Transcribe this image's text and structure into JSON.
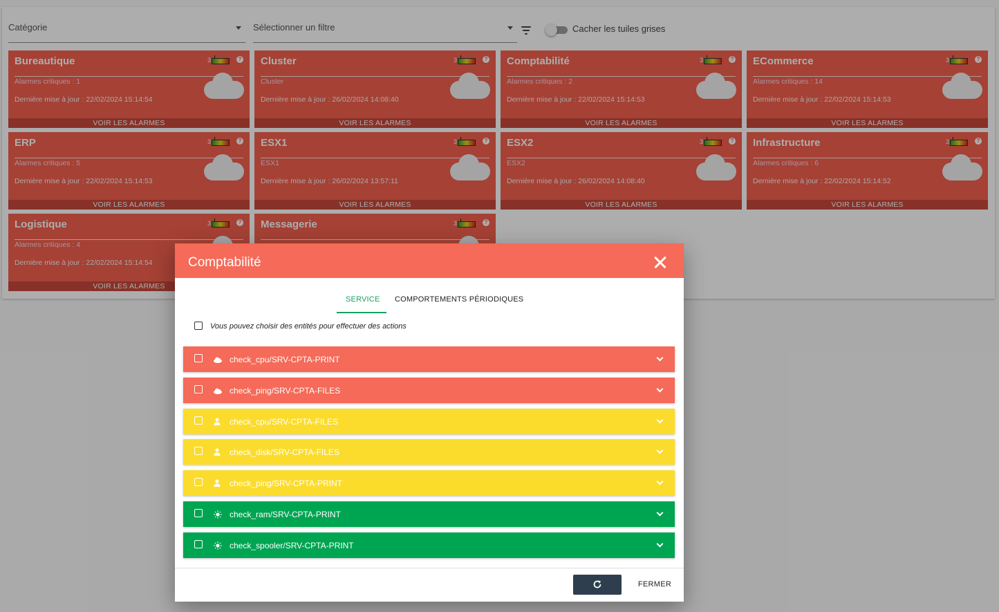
{
  "toolbar": {
    "category_placeholder": "Catégorie",
    "filter_placeholder": "Sélectionner un filtre",
    "hide_grey_label": "Cacher les tuiles grises"
  },
  "tiles": [
    {
      "name": "Bureautique",
      "sub": "Alarmes critiques : 1",
      "date": "Dernière mise à jour : 22/02/2024 15:14:54",
      "count": "3",
      "button": "VOIR LES ALARMES"
    },
    {
      "name": "Cluster",
      "sub": "Cluster",
      "date": "Dernière mise à jour : 26/02/2024 14:08:40",
      "count": "3",
      "button": "VOIR LES ALARMES"
    },
    {
      "name": "Comptabilité",
      "sub": "Alarmes critiques : 2",
      "date": "Dernière mise à jour : 22/02/2024 15:14:53",
      "count": "3",
      "button": "VOIR LES ALARMES"
    },
    {
      "name": "ECommerce",
      "sub": "Alarmes critiques : 14",
      "date": "Dernière mise à jour : 22/02/2024 15:14:53",
      "count": "3",
      "button": "VOIR LES ALARMES"
    },
    {
      "name": "ERP",
      "sub": "Alarmes critiques : 5",
      "date": "Dernière mise à jour : 22/02/2024 15:14:53",
      "count": "3",
      "button": "VOIR LES ALARMES"
    },
    {
      "name": "ESX1",
      "sub": "ESX1",
      "date": "Dernière mise à jour : 26/02/2024 13:57:11",
      "count": "3",
      "button": "VOIR LES ALARMES"
    },
    {
      "name": "ESX2",
      "sub": "ESX2",
      "date": "Dernière mise à jour : 26/02/2024 14:08:40",
      "count": "3",
      "button": "VOIR LES ALARMES"
    },
    {
      "name": "Infrastructure",
      "sub": "Alarmes critiques : 6",
      "date": "Dernière mise à jour : 22/02/2024 15:14:52",
      "count": "3",
      "button": "VOIR LES ALARMES"
    },
    {
      "name": "Logistique",
      "sub": "Alarmes critiques : 4",
      "date": "Dernière mise à jour : 22/02/2024 15:14:54",
      "count": "3",
      "button": "VOIR LES ALARMES"
    },
    {
      "name": "Messagerie",
      "sub": "",
      "date": "",
      "count": "3",
      "button": ""
    }
  ],
  "dialog": {
    "title": "Comptabilité",
    "tabs": [
      "SERVICE",
      "COMPORTEMENTS PÉRIODIQUES"
    ],
    "hint": "Vous pouvez choisir des entités pour effectuer des actions",
    "close_label": "FERMER",
    "services": [
      {
        "label": "check_cpu/SRV-CPTA-PRINT",
        "state": "critical",
        "icon": "cloud-icon",
        "color": "#f56a58"
      },
      {
        "label": "check_ping/SRV-CPTA-FILES",
        "state": "critical",
        "icon": "cloud-icon",
        "color": "#f56a58"
      },
      {
        "label": "check_cpu/SRV-CPTA-FILES",
        "state": "minor",
        "icon": "person-icon",
        "color": "#fbdc2c"
      },
      {
        "label": "check_disk/SRV-CPTA-FILES",
        "state": "minor",
        "icon": "person-icon",
        "color": "#fbdc2c"
      },
      {
        "label": "check_ping/SRV-CPTA-PRINT",
        "state": "minor",
        "icon": "person-icon",
        "color": "#fbdc2c"
      },
      {
        "label": "check_ram/SRV-CPTA-PRINT",
        "state": "ok",
        "icon": "sun-icon",
        "color": "#00a551"
      },
      {
        "label": "check_spooler/SRV-CPTA-PRINT",
        "state": "ok",
        "icon": "sun-icon",
        "color": "#00a551"
      }
    ]
  }
}
